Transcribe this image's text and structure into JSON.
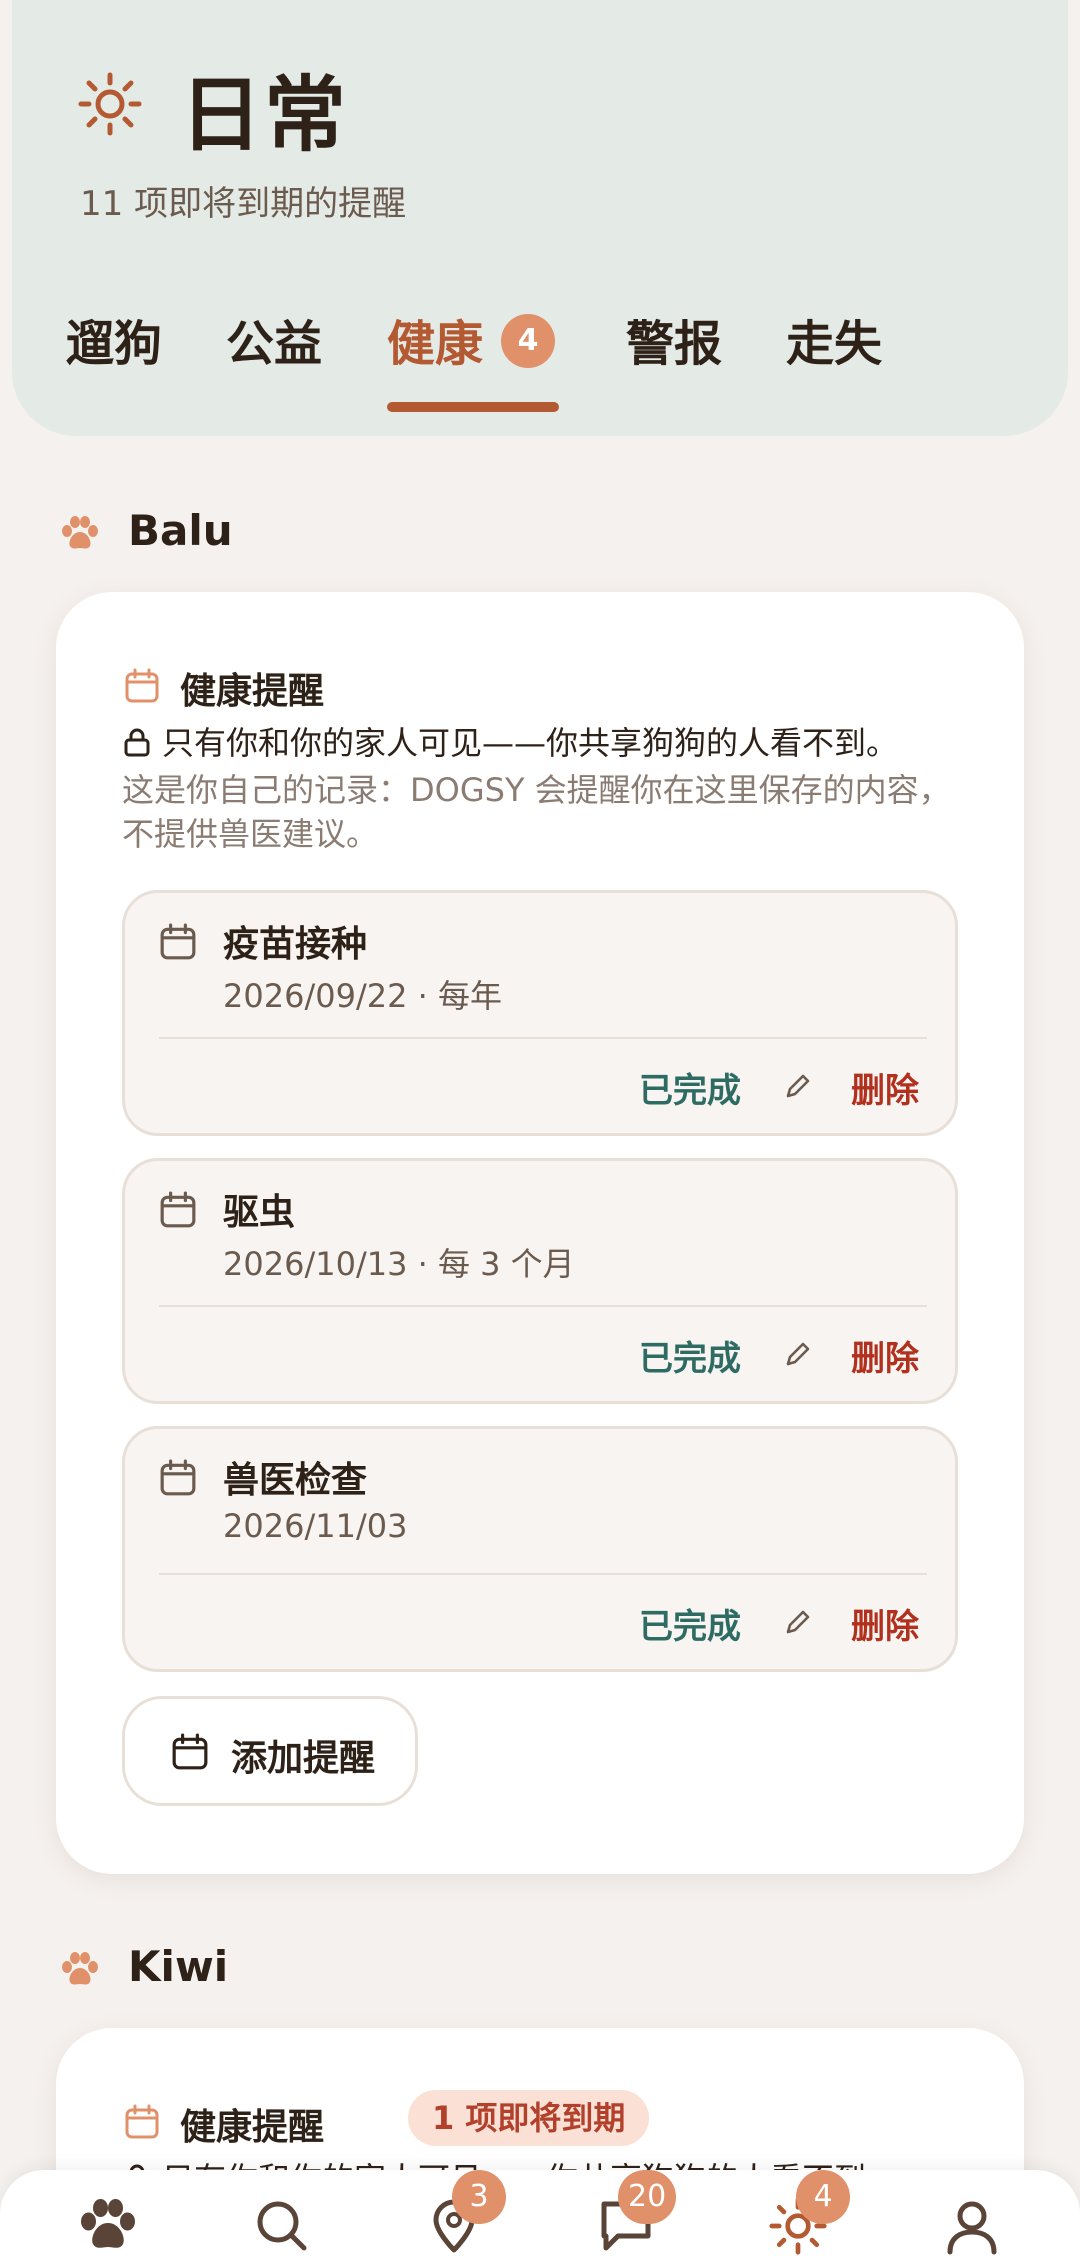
{
  "header": {
    "title": "日常",
    "subtitle": "11 项即将到期的提醒",
    "tabs": [
      {
        "label": "遛狗"
      },
      {
        "label": "公益"
      },
      {
        "label": "健康",
        "badge": "4"
      },
      {
        "label": "警报"
      },
      {
        "label": "走失"
      }
    ]
  },
  "dogs": [
    {
      "name": "Balu",
      "card_title": "健康提醒",
      "privacy": "只有你和你的家人可见——你共享狗狗的人看不到。",
      "disclaimer": "这是你自己的记录：DOGSY 会提醒你在这里保存的内容，不提供兽医建议。",
      "reminders": [
        {
          "name": "疫苗接种",
          "meta": "2026/09/22 · 每年"
        },
        {
          "name": "驱虫",
          "meta": "2026/10/13 · 每 3 个月"
        },
        {
          "name": "兽医检查",
          "meta": "2026/11/03"
        }
      ],
      "add_label": "添加提醒"
    },
    {
      "name": "Kiwi",
      "card_title": "健康提醒",
      "due_badge": "1 项即将到期",
      "privacy": "只有你和你的家人可见——你共享狗狗的人看不到。"
    }
  ],
  "actions": {
    "done": "已完成",
    "delete": "删除"
  },
  "bottom_nav": {
    "items": [
      {
        "icon": "paw-icon"
      },
      {
        "icon": "search-icon"
      },
      {
        "icon": "map-pin-icon",
        "badge": "3"
      },
      {
        "icon": "chat-icon",
        "badge": "20"
      },
      {
        "icon": "sun-icon",
        "badge": "4"
      },
      {
        "icon": "profile-icon"
      }
    ]
  },
  "colors": {
    "accent": "#b45a33",
    "badge": "#e0916a",
    "done": "#2e6b62",
    "delete": "#b2301e"
  }
}
